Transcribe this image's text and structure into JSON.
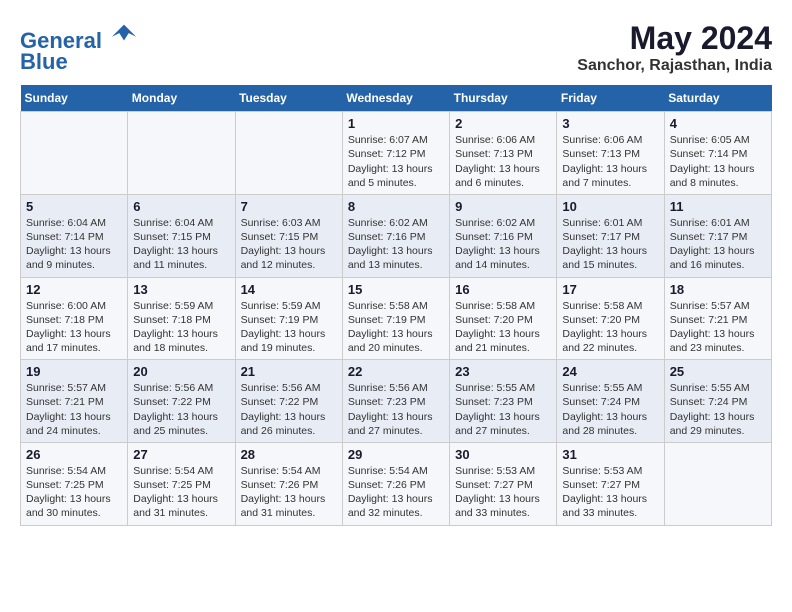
{
  "header": {
    "logo_line1": "General",
    "logo_line2": "Blue",
    "title": "May 2024",
    "subtitle": "Sanchor, Rajasthan, India"
  },
  "days_of_week": [
    "Sunday",
    "Monday",
    "Tuesday",
    "Wednesday",
    "Thursday",
    "Friday",
    "Saturday"
  ],
  "weeks": [
    [
      {
        "num": "",
        "info": ""
      },
      {
        "num": "",
        "info": ""
      },
      {
        "num": "",
        "info": ""
      },
      {
        "num": "1",
        "info": "Sunrise: 6:07 AM\nSunset: 7:12 PM\nDaylight: 13 hours and 5 minutes."
      },
      {
        "num": "2",
        "info": "Sunrise: 6:06 AM\nSunset: 7:13 PM\nDaylight: 13 hours and 6 minutes."
      },
      {
        "num": "3",
        "info": "Sunrise: 6:06 AM\nSunset: 7:13 PM\nDaylight: 13 hours and 7 minutes."
      },
      {
        "num": "4",
        "info": "Sunrise: 6:05 AM\nSunset: 7:14 PM\nDaylight: 13 hours and 8 minutes."
      }
    ],
    [
      {
        "num": "5",
        "info": "Sunrise: 6:04 AM\nSunset: 7:14 PM\nDaylight: 13 hours and 9 minutes."
      },
      {
        "num": "6",
        "info": "Sunrise: 6:04 AM\nSunset: 7:15 PM\nDaylight: 13 hours and 11 minutes."
      },
      {
        "num": "7",
        "info": "Sunrise: 6:03 AM\nSunset: 7:15 PM\nDaylight: 13 hours and 12 minutes."
      },
      {
        "num": "8",
        "info": "Sunrise: 6:02 AM\nSunset: 7:16 PM\nDaylight: 13 hours and 13 minutes."
      },
      {
        "num": "9",
        "info": "Sunrise: 6:02 AM\nSunset: 7:16 PM\nDaylight: 13 hours and 14 minutes."
      },
      {
        "num": "10",
        "info": "Sunrise: 6:01 AM\nSunset: 7:17 PM\nDaylight: 13 hours and 15 minutes."
      },
      {
        "num": "11",
        "info": "Sunrise: 6:01 AM\nSunset: 7:17 PM\nDaylight: 13 hours and 16 minutes."
      }
    ],
    [
      {
        "num": "12",
        "info": "Sunrise: 6:00 AM\nSunset: 7:18 PM\nDaylight: 13 hours and 17 minutes."
      },
      {
        "num": "13",
        "info": "Sunrise: 5:59 AM\nSunset: 7:18 PM\nDaylight: 13 hours and 18 minutes."
      },
      {
        "num": "14",
        "info": "Sunrise: 5:59 AM\nSunset: 7:19 PM\nDaylight: 13 hours and 19 minutes."
      },
      {
        "num": "15",
        "info": "Sunrise: 5:58 AM\nSunset: 7:19 PM\nDaylight: 13 hours and 20 minutes."
      },
      {
        "num": "16",
        "info": "Sunrise: 5:58 AM\nSunset: 7:20 PM\nDaylight: 13 hours and 21 minutes."
      },
      {
        "num": "17",
        "info": "Sunrise: 5:58 AM\nSunset: 7:20 PM\nDaylight: 13 hours and 22 minutes."
      },
      {
        "num": "18",
        "info": "Sunrise: 5:57 AM\nSunset: 7:21 PM\nDaylight: 13 hours and 23 minutes."
      }
    ],
    [
      {
        "num": "19",
        "info": "Sunrise: 5:57 AM\nSunset: 7:21 PM\nDaylight: 13 hours and 24 minutes."
      },
      {
        "num": "20",
        "info": "Sunrise: 5:56 AM\nSunset: 7:22 PM\nDaylight: 13 hours and 25 minutes."
      },
      {
        "num": "21",
        "info": "Sunrise: 5:56 AM\nSunset: 7:22 PM\nDaylight: 13 hours and 26 minutes."
      },
      {
        "num": "22",
        "info": "Sunrise: 5:56 AM\nSunset: 7:23 PM\nDaylight: 13 hours and 27 minutes."
      },
      {
        "num": "23",
        "info": "Sunrise: 5:55 AM\nSunset: 7:23 PM\nDaylight: 13 hours and 27 minutes."
      },
      {
        "num": "24",
        "info": "Sunrise: 5:55 AM\nSunset: 7:24 PM\nDaylight: 13 hours and 28 minutes."
      },
      {
        "num": "25",
        "info": "Sunrise: 5:55 AM\nSunset: 7:24 PM\nDaylight: 13 hours and 29 minutes."
      }
    ],
    [
      {
        "num": "26",
        "info": "Sunrise: 5:54 AM\nSunset: 7:25 PM\nDaylight: 13 hours and 30 minutes."
      },
      {
        "num": "27",
        "info": "Sunrise: 5:54 AM\nSunset: 7:25 PM\nDaylight: 13 hours and 31 minutes."
      },
      {
        "num": "28",
        "info": "Sunrise: 5:54 AM\nSunset: 7:26 PM\nDaylight: 13 hours and 31 minutes."
      },
      {
        "num": "29",
        "info": "Sunrise: 5:54 AM\nSunset: 7:26 PM\nDaylight: 13 hours and 32 minutes."
      },
      {
        "num": "30",
        "info": "Sunrise: 5:53 AM\nSunset: 7:27 PM\nDaylight: 13 hours and 33 minutes."
      },
      {
        "num": "31",
        "info": "Sunrise: 5:53 AM\nSunset: 7:27 PM\nDaylight: 13 hours and 33 minutes."
      },
      {
        "num": "",
        "info": ""
      }
    ]
  ]
}
